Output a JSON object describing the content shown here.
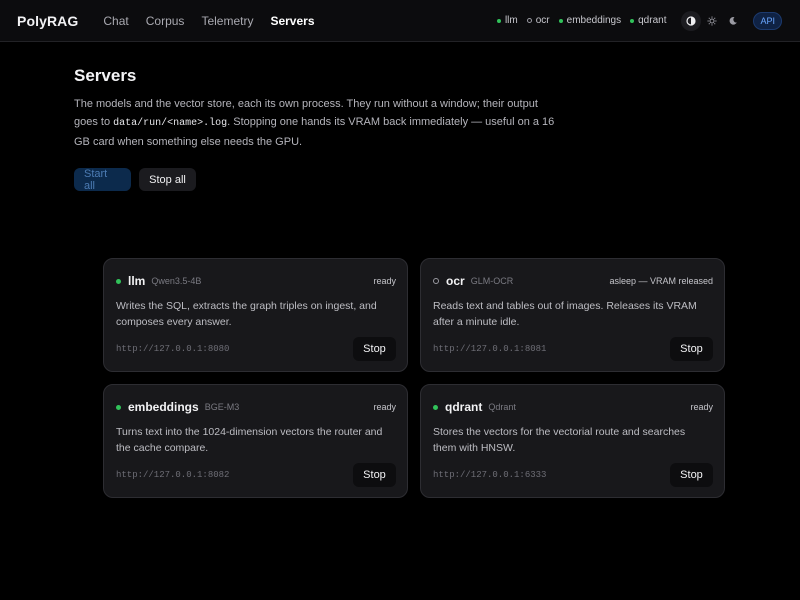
{
  "app": {
    "brand": "PolyRAG"
  },
  "nav": {
    "items": [
      "Chat",
      "Corpus",
      "Telemetry",
      "Servers"
    ],
    "active": "Servers"
  },
  "status": [
    {
      "name": "llm",
      "up": true
    },
    {
      "name": "ocr",
      "up": false
    },
    {
      "name": "embeddings",
      "up": true
    },
    {
      "name": "qdrant",
      "up": true
    }
  ],
  "theme": {
    "options": [
      "auto-icon",
      "sun-icon",
      "moon-icon"
    ],
    "active": "auto-icon"
  },
  "api_label": "API",
  "colors": {
    "up": "#31c25a",
    "accent": "#6aa6ff",
    "background": "#000000",
    "card": "#18181b"
  },
  "page": {
    "title": "Servers",
    "intro_1": "The models and the vector store, each its own process. They run without a window; their output goes to ",
    "intro_code": "data/run/<name>.log",
    "intro_2": ". Stopping one hands its VRAM back immediately — useful on a 16 GB card when something else needs the GPU.",
    "start_all": "Start all",
    "stop_all": "Stop all"
  },
  "servers": [
    {
      "name": "llm",
      "model": "Qwen3.5-4B",
      "state": "ready",
      "up": true,
      "description": "Writes the SQL, extracts the graph triples on ingest, and composes every answer.",
      "url": "http://127.0.0.1:8080",
      "action": "Stop"
    },
    {
      "name": "ocr",
      "model": "GLM-OCR",
      "state": "asleep — VRAM released",
      "up": false,
      "description": "Reads text and tables out of images. Releases its VRAM after a minute idle.",
      "url": "http://127.0.0.1:8081",
      "action": "Stop"
    },
    {
      "name": "embeddings",
      "model": "BGE-M3",
      "state": "ready",
      "up": true,
      "description": "Turns text into the 1024-dimension vectors the router and the cache compare.",
      "url": "http://127.0.0.1:8082",
      "action": "Stop"
    },
    {
      "name": "qdrant",
      "model": "Qdrant",
      "state": "ready",
      "up": true,
      "description": "Stores the vectors for the vectorial route and searches them with HNSW.",
      "url": "http://127.0.0.1:6333",
      "action": "Stop"
    }
  ]
}
